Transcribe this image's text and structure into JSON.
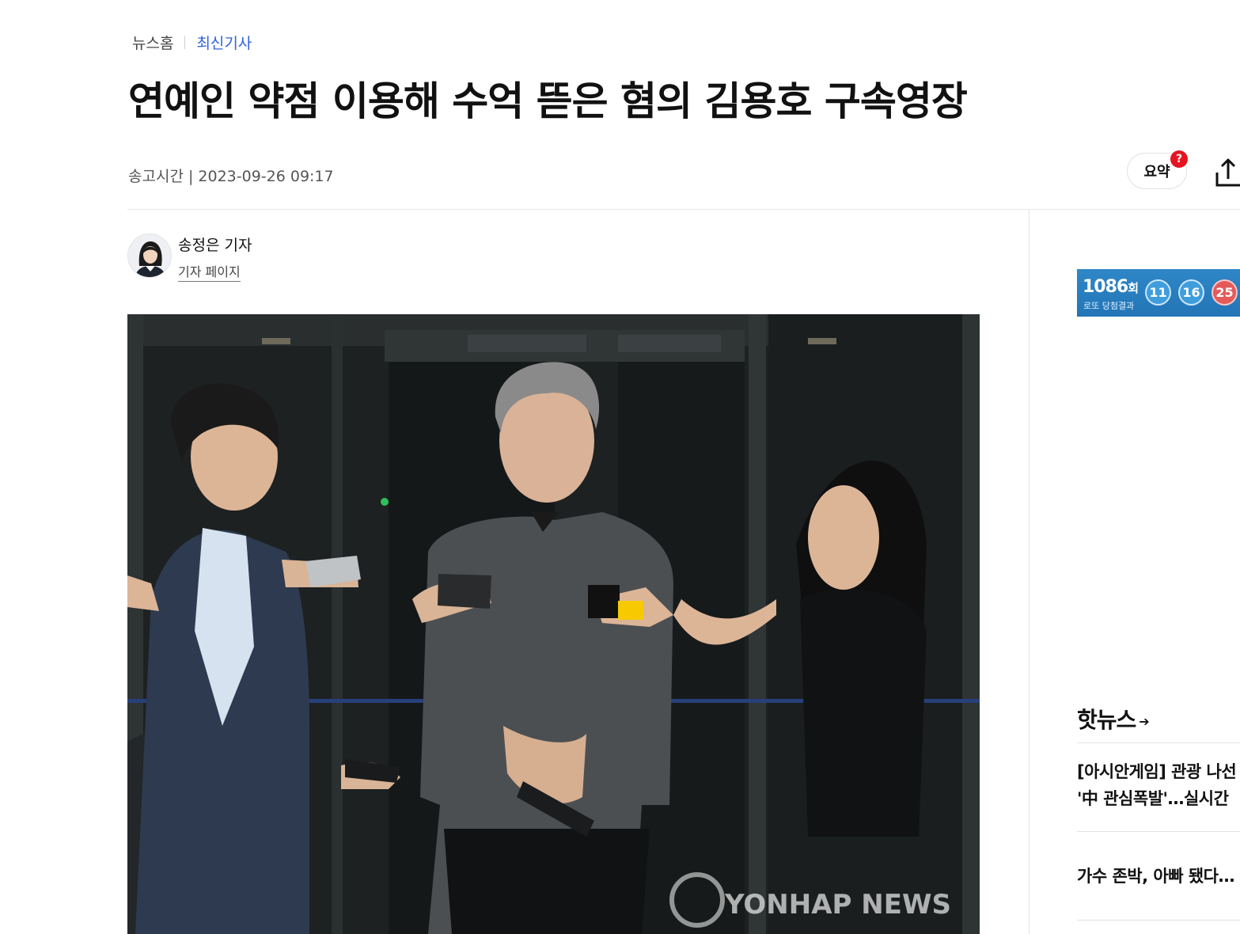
{
  "breadcrumb": {
    "home": "뉴스홈",
    "current": "최신기사"
  },
  "article": {
    "title": "연예인 약점 이용해 수억 뜯은 혐의 김용호 구속영장",
    "meta": "송고시간 | 2023-09-26 09:17"
  },
  "toolbar": {
    "summary_label": "요약",
    "summary_badge": "?"
  },
  "reporter": {
    "name": "송정은 기자",
    "page_link": "기자 페이지"
  },
  "photo": {
    "watermark": "YONHAP NEWS",
    "accent_color": "#f7c900"
  },
  "lotto": {
    "round": "1086",
    "round_suffix": "회",
    "subtitle": "로또 당첨결과",
    "numbers": [
      "11",
      "16",
      "25"
    ]
  },
  "hot_news": {
    "title": "핫뉴스",
    "items": [
      {
        "line1": "[아시안게임] 관광 나선",
        "line2": "'中 관심폭발'…실시간"
      },
      {
        "line1": "가수 존박, 아빠 됐다…"
      }
    ]
  },
  "colors": {
    "link_blue": "#2f63d8",
    "badge_red": "#e5141f",
    "lotto_blue": "#2275b6"
  }
}
